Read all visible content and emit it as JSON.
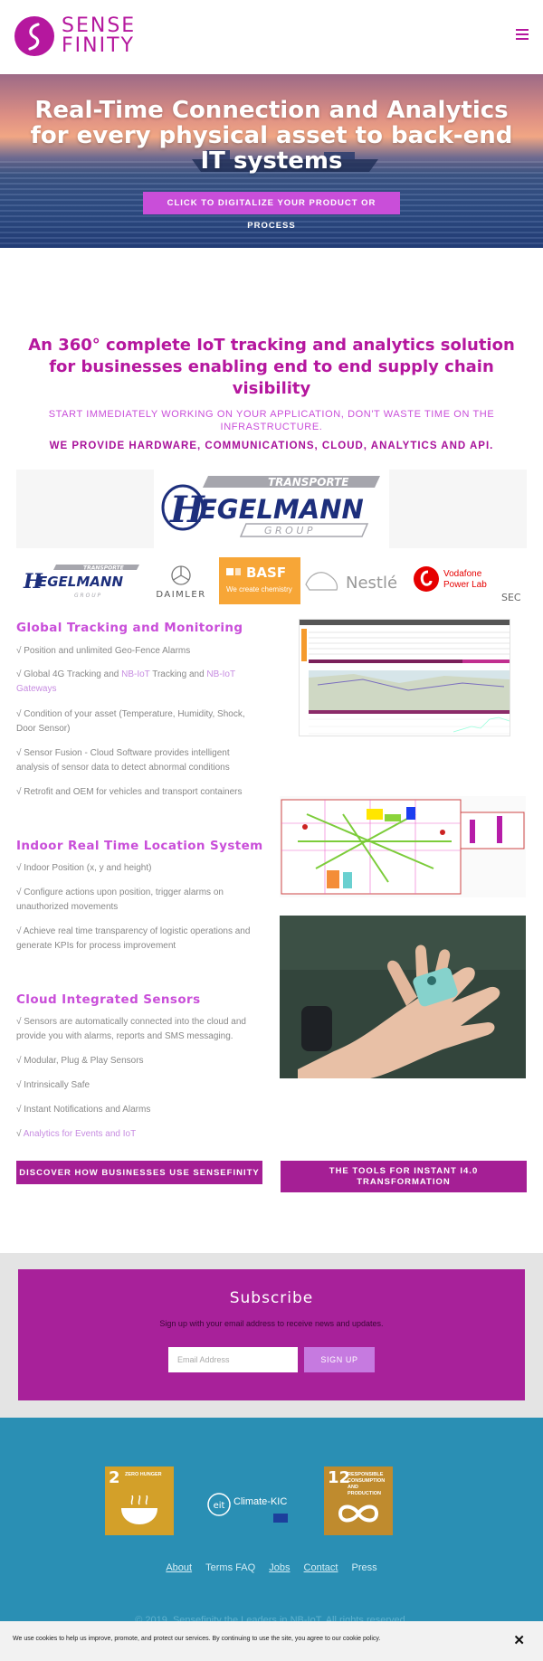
{
  "header": {
    "logo_line1": "SENSE",
    "logo_line2": "FINITY",
    "menu_icon": "hamburger-icon"
  },
  "hero": {
    "title": "Real-Time Connection and Analytics for every physical asset to back-end IT systems",
    "cta": "CLICK TO DIGITALIZE YOUR PRODUCT OR PROCESS"
  },
  "intro": {
    "title": "An 360° complete IoT tracking and analytics solution for businesses enabling end to end supply chain visibility",
    "subtitle": "START IMMEDIATELY WORKING ON YOUR APPLICATION, DON'T WASTE TIME ON THE INFRASTRUCTURE.",
    "subtitle2": "WE PROVIDE HARDWARE, COMMUNICATIONS, CLOUD, ANALYTICS AND API."
  },
  "banner": {
    "brand_top": "TRANSPORTE",
    "brand_main": "EGELMANN",
    "brand_letter": "H",
    "brand_sub": "G R O U P"
  },
  "clients": [
    {
      "name": "Hegelmann",
      "top": "TRANSPORTE",
      "main": "EGELMANN",
      "sub": "G R O U P"
    },
    {
      "name": "DAIMLER"
    },
    {
      "name": "BASF",
      "sub": "We create chemistry"
    },
    {
      "name": "Nestlé"
    },
    {
      "name": "Vodafone",
      "sub": "Power Lab"
    },
    {
      "name": "SEC"
    }
  ],
  "global_tracking": {
    "title": "Global Tracking and Monitoring",
    "bullets": [
      "√ Position and unlimited Geo-Fence Alarms",
      "√ Condition of your asset (Temperature, Humidity, Shock, Door Sensor)",
      "√ Sensor Fusion - Cloud Software provides intelligent analysis of sensor data to detect abnormal conditions",
      "√ Retrofit and OEM for vehicles and transport containers"
    ],
    "bullet2_pre": "√ Global 4G Tracking and ",
    "bullet2_link1": "NB-IoT",
    "bullet2_mid": " Tracking and ",
    "bullet2_link2": "NB-IoT Gateways"
  },
  "indoor": {
    "title": "Indoor Real Time Location System",
    "bullets": [
      "√ Indoor Position (x, y and height)",
      "√ Configure actions upon position, trigger alarms on unauthorized movements",
      "√ Achieve real time transparency of logistic operations and generate KPIs for process improvement"
    ]
  },
  "cloud": {
    "title": "Cloud Integrated Sensors",
    "bullets": [
      "√  Sensors are automatically connected into the cloud and provide you with alarms, reports and SMS messaging.",
      "√ Modular, Plug & Play Sensors",
      "√  Intrinsically Safe",
      "√  Instant Notifications and Alarms"
    ],
    "bullet_link_prefix": "√  ",
    "bullet_link": "Analytics for Events and IoT"
  },
  "buttons": {
    "discover": "DISCOVER HOW BUSINESSES USE SENSEFINITY",
    "tools": "THE TOOLS FOR INSTANT I4.0 TRANSFORMATION"
  },
  "subscribe": {
    "title": "Subscribe",
    "text": "Sign up with your email address to receive news and updates.",
    "placeholder": "Email Address",
    "button": "SIGN UP"
  },
  "footer": {
    "sdg1_num": "2",
    "sdg1_label": "ZERO HUNGER",
    "sdg2_num": "12",
    "sdg2_label": "RESPONSIBLE CONSUMPTION AND PRODUCTION",
    "climate_label": "Climate-KIC",
    "climate_mark": "eit",
    "links": [
      "About",
      "Terms FAQ",
      "Jobs",
      "Contact",
      "Press"
    ],
    "copyright": "© 2019, Sensefinity the Leaders in NB-IoT. All rights reserved."
  },
  "cookie": {
    "text": "We use cookies to help us improve, promote, and protect our services. By continuing to use the site, you agree to our cookie policy.",
    "close": "✕"
  },
  "colors": {
    "brand": "#b5179e",
    "accent": "#c94ed9",
    "footer": "#2a8fb4",
    "subscribe": "#a8219a"
  }
}
